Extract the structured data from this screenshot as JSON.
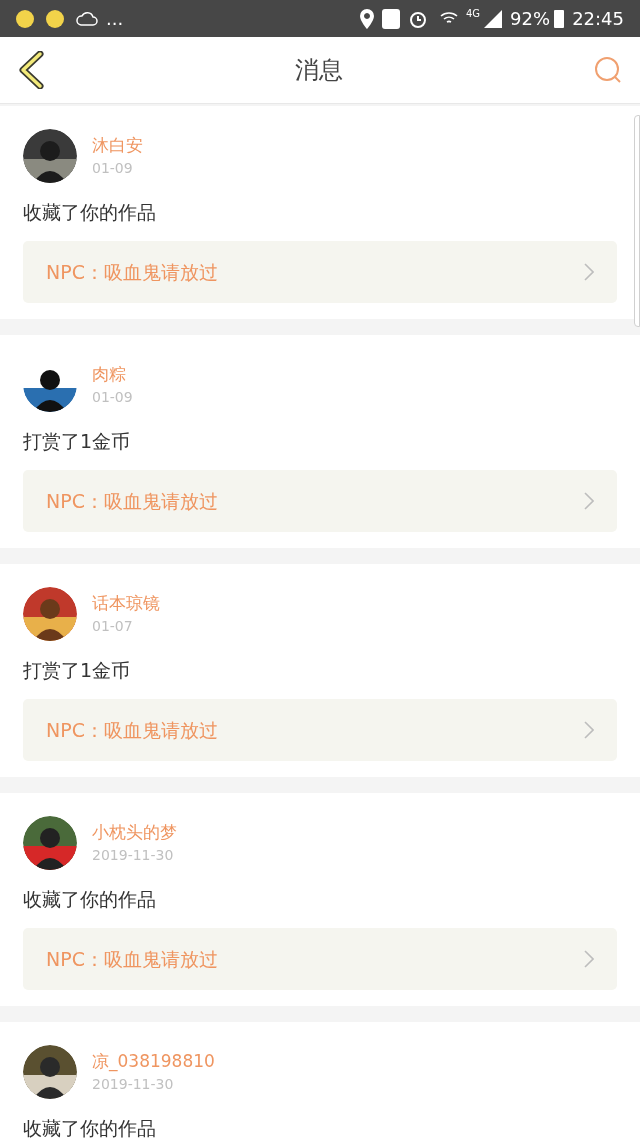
{
  "status_bar": {
    "overflow": "...",
    "network": "4G",
    "battery": "92%",
    "time": "22:45"
  },
  "header": {
    "title": "消息"
  },
  "messages": [
    {
      "name": "沐白安",
      "date": "01-09",
      "action": "收藏了你的作品",
      "work": "NPC：吸血鬼请放过"
    },
    {
      "name": "肉粽",
      "date": "01-09",
      "action": "打赏了1金币",
      "work": "NPC：吸血鬼请放过"
    },
    {
      "name": "话本琼镜",
      "date": "01-07",
      "action": "打赏了1金币",
      "work": "NPC：吸血鬼请放过"
    },
    {
      "name": "小枕头的梦",
      "date": "2019-11-30",
      "action": "收藏了你的作品",
      "work": "NPC：吸血鬼请放过"
    },
    {
      "name": "凉_038198810",
      "date": "2019-11-30",
      "action": "收藏了你的作品"
    }
  ]
}
